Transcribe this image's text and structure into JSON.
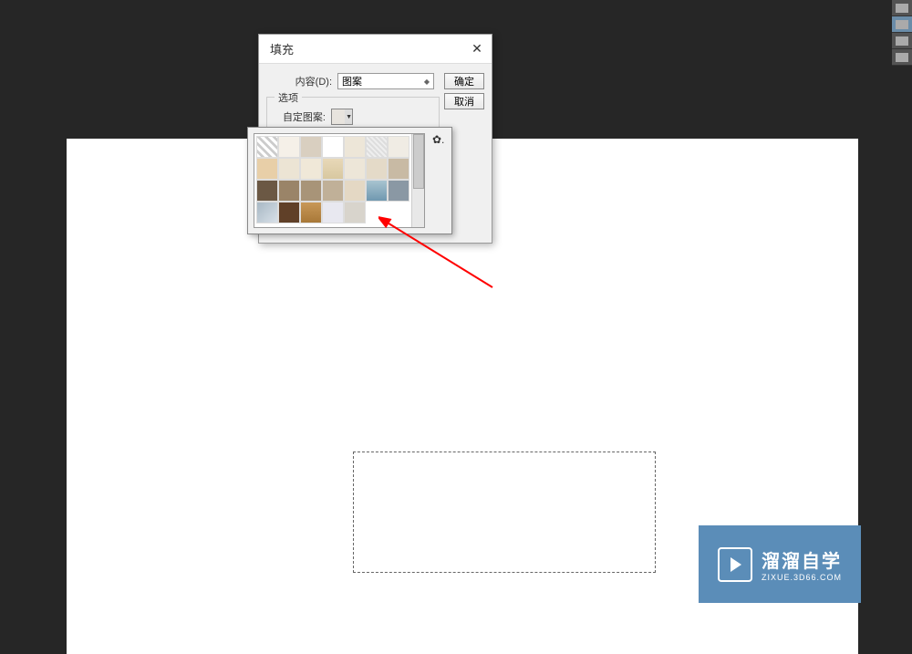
{
  "dialog": {
    "title": "填充",
    "content_label": "内容(D):",
    "content_value": "图案",
    "ok_label": "确定",
    "cancel_label": "取消",
    "options_label": "选项",
    "pattern_label": "自定图案:"
  },
  "picker": {
    "gear_label": "✿."
  },
  "watermark": {
    "main": "溜溜自学",
    "sub": "ZIXUE.3D66.COM"
  }
}
